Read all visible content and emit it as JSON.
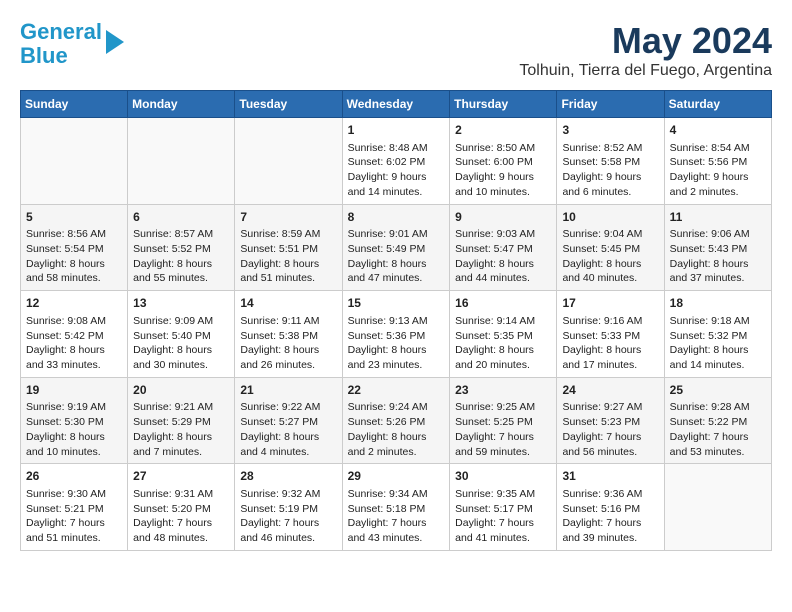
{
  "logo": {
    "line1": "General",
    "line2": "Blue",
    "arrow": true
  },
  "title": "May 2024",
  "subtitle": "Tolhuin, Tierra del Fuego, Argentina",
  "weekdays": [
    "Sunday",
    "Monday",
    "Tuesday",
    "Wednesday",
    "Thursday",
    "Friday",
    "Saturday"
  ],
  "weeks": [
    [
      {
        "day": "",
        "info": ""
      },
      {
        "day": "",
        "info": ""
      },
      {
        "day": "",
        "info": ""
      },
      {
        "day": "1",
        "info": "Sunrise: 8:48 AM\nSunset: 6:02 PM\nDaylight: 9 hours\nand 14 minutes."
      },
      {
        "day": "2",
        "info": "Sunrise: 8:50 AM\nSunset: 6:00 PM\nDaylight: 9 hours\nand 10 minutes."
      },
      {
        "day": "3",
        "info": "Sunrise: 8:52 AM\nSunset: 5:58 PM\nDaylight: 9 hours\nand 6 minutes."
      },
      {
        "day": "4",
        "info": "Sunrise: 8:54 AM\nSunset: 5:56 PM\nDaylight: 9 hours\nand 2 minutes."
      }
    ],
    [
      {
        "day": "5",
        "info": "Sunrise: 8:56 AM\nSunset: 5:54 PM\nDaylight: 8 hours\nand 58 minutes."
      },
      {
        "day": "6",
        "info": "Sunrise: 8:57 AM\nSunset: 5:52 PM\nDaylight: 8 hours\nand 55 minutes."
      },
      {
        "day": "7",
        "info": "Sunrise: 8:59 AM\nSunset: 5:51 PM\nDaylight: 8 hours\nand 51 minutes."
      },
      {
        "day": "8",
        "info": "Sunrise: 9:01 AM\nSunset: 5:49 PM\nDaylight: 8 hours\nand 47 minutes."
      },
      {
        "day": "9",
        "info": "Sunrise: 9:03 AM\nSunset: 5:47 PM\nDaylight: 8 hours\nand 44 minutes."
      },
      {
        "day": "10",
        "info": "Sunrise: 9:04 AM\nSunset: 5:45 PM\nDaylight: 8 hours\nand 40 minutes."
      },
      {
        "day": "11",
        "info": "Sunrise: 9:06 AM\nSunset: 5:43 PM\nDaylight: 8 hours\nand 37 minutes."
      }
    ],
    [
      {
        "day": "12",
        "info": "Sunrise: 9:08 AM\nSunset: 5:42 PM\nDaylight: 8 hours\nand 33 minutes."
      },
      {
        "day": "13",
        "info": "Sunrise: 9:09 AM\nSunset: 5:40 PM\nDaylight: 8 hours\nand 30 minutes."
      },
      {
        "day": "14",
        "info": "Sunrise: 9:11 AM\nSunset: 5:38 PM\nDaylight: 8 hours\nand 26 minutes."
      },
      {
        "day": "15",
        "info": "Sunrise: 9:13 AM\nSunset: 5:36 PM\nDaylight: 8 hours\nand 23 minutes."
      },
      {
        "day": "16",
        "info": "Sunrise: 9:14 AM\nSunset: 5:35 PM\nDaylight: 8 hours\nand 20 minutes."
      },
      {
        "day": "17",
        "info": "Sunrise: 9:16 AM\nSunset: 5:33 PM\nDaylight: 8 hours\nand 17 minutes."
      },
      {
        "day": "18",
        "info": "Sunrise: 9:18 AM\nSunset: 5:32 PM\nDaylight: 8 hours\nand 14 minutes."
      }
    ],
    [
      {
        "day": "19",
        "info": "Sunrise: 9:19 AM\nSunset: 5:30 PM\nDaylight: 8 hours\nand 10 minutes."
      },
      {
        "day": "20",
        "info": "Sunrise: 9:21 AM\nSunset: 5:29 PM\nDaylight: 8 hours\nand 7 minutes."
      },
      {
        "day": "21",
        "info": "Sunrise: 9:22 AM\nSunset: 5:27 PM\nDaylight: 8 hours\nand 4 minutes."
      },
      {
        "day": "22",
        "info": "Sunrise: 9:24 AM\nSunset: 5:26 PM\nDaylight: 8 hours\nand 2 minutes."
      },
      {
        "day": "23",
        "info": "Sunrise: 9:25 AM\nSunset: 5:25 PM\nDaylight: 7 hours\nand 59 minutes."
      },
      {
        "day": "24",
        "info": "Sunrise: 9:27 AM\nSunset: 5:23 PM\nDaylight: 7 hours\nand 56 minutes."
      },
      {
        "day": "25",
        "info": "Sunrise: 9:28 AM\nSunset: 5:22 PM\nDaylight: 7 hours\nand 53 minutes."
      }
    ],
    [
      {
        "day": "26",
        "info": "Sunrise: 9:30 AM\nSunset: 5:21 PM\nDaylight: 7 hours\nand 51 minutes."
      },
      {
        "day": "27",
        "info": "Sunrise: 9:31 AM\nSunset: 5:20 PM\nDaylight: 7 hours\nand 48 minutes."
      },
      {
        "day": "28",
        "info": "Sunrise: 9:32 AM\nSunset: 5:19 PM\nDaylight: 7 hours\nand 46 minutes."
      },
      {
        "day": "29",
        "info": "Sunrise: 9:34 AM\nSunset: 5:18 PM\nDaylight: 7 hours\nand 43 minutes."
      },
      {
        "day": "30",
        "info": "Sunrise: 9:35 AM\nSunset: 5:17 PM\nDaylight: 7 hours\nand 41 minutes."
      },
      {
        "day": "31",
        "info": "Sunrise: 9:36 AM\nSunset: 5:16 PM\nDaylight: 7 hours\nand 39 minutes."
      },
      {
        "day": "",
        "info": ""
      }
    ]
  ]
}
